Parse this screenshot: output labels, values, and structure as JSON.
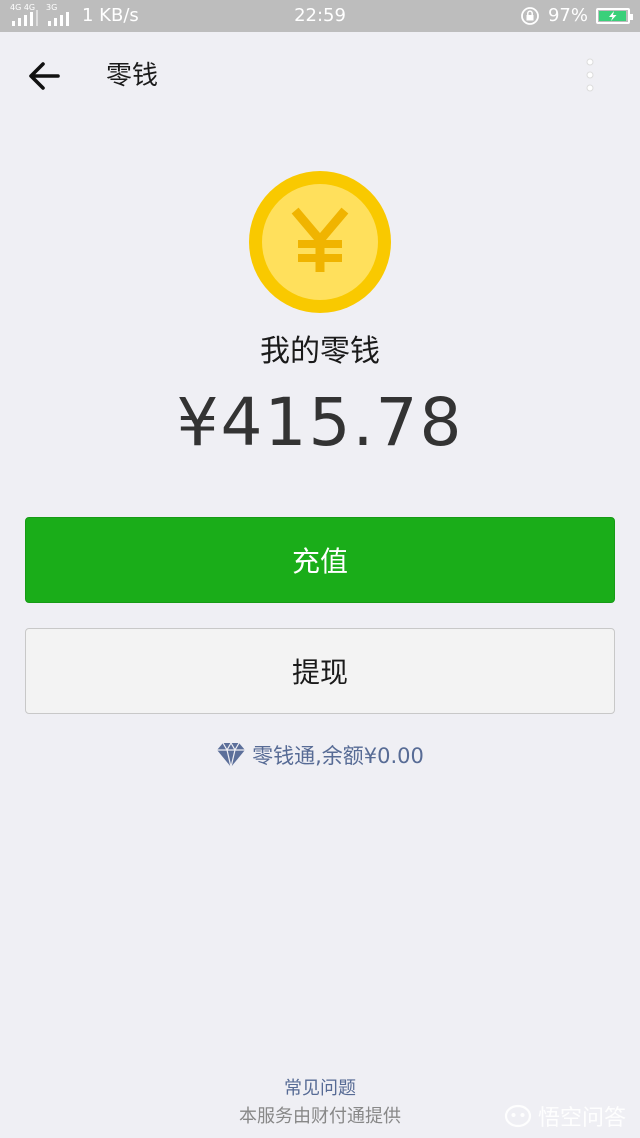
{
  "status_bar": {
    "signal1_label": "4G 4G",
    "signal2_label": "3G",
    "speed": "1 KB/s",
    "time": "22:59",
    "battery_percent": "97%",
    "battery_level": 0.97
  },
  "header": {
    "title": "零钱"
  },
  "balance": {
    "label": "我的零钱",
    "amount": "¥415.78"
  },
  "buttons": {
    "recharge": "充值",
    "withdraw": "提现"
  },
  "lqt": {
    "text": "零钱通,余额¥0.00"
  },
  "footer": {
    "faq": "常见问题",
    "provider": "本服务由财付通提供"
  },
  "watermark": {
    "text": "悟空问答"
  },
  "colors": {
    "green": "#1aad19",
    "link": "#576b95",
    "coin_outer": "#f9c900",
    "coin_inner": "#ffe05c",
    "coin_symbol": "#f0b400"
  }
}
